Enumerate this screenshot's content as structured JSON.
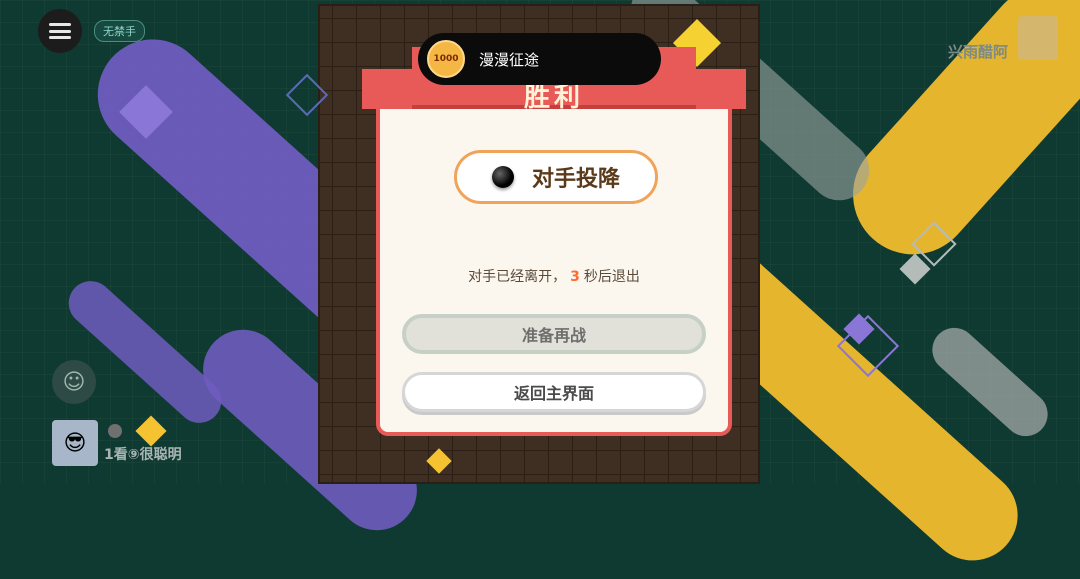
{
  "top_bar": {
    "menu_icon": "menu-icon",
    "rule_tag": "无禁手"
  },
  "opponent": {
    "name": "兴雨醋阿"
  },
  "player": {
    "name": "1看⑨很聪明",
    "stone_color": "white"
  },
  "chat": {
    "icon": "chat-icon"
  },
  "toast": {
    "badge_text": "1000",
    "text": "漫漫征途"
  },
  "dialog": {
    "ribbon_title": "胜利",
    "result_text": "对手投降",
    "result_stone": "black",
    "countdown_prefix": "对手已经离开，",
    "countdown_seconds": "3",
    "countdown_suffix": "秒后退出",
    "ready_button": "准备再战",
    "home_button": "返回主界面"
  },
  "colors": {
    "background": "#0f3a31",
    "ribbon": "#e85a57",
    "accent_orange": "#f0a35a",
    "countdown_number": "#ff6b2d",
    "purple_stripe": "#6f5cc0",
    "yellow_stripe": "#e6b52e"
  }
}
